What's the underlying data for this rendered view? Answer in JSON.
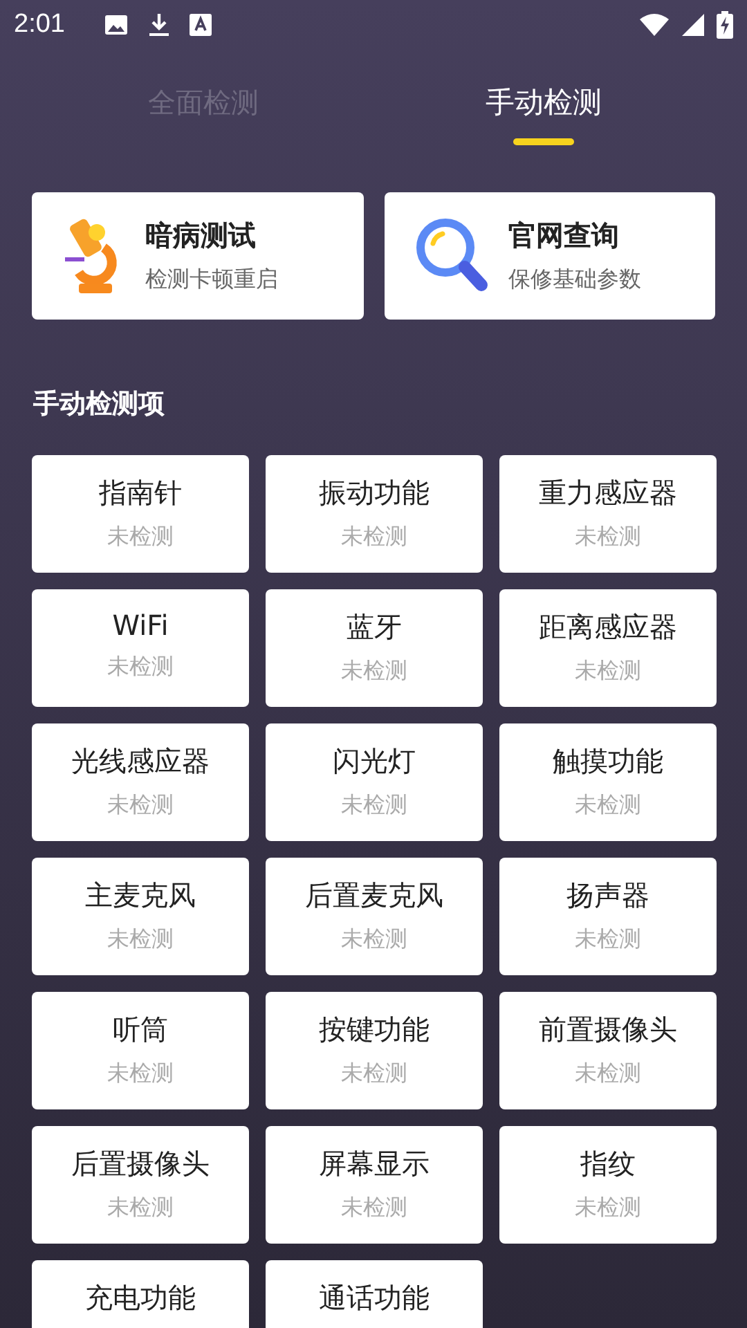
{
  "status_bar": {
    "time": "2:01"
  },
  "tabs": [
    {
      "label": "全面检测",
      "selected": false
    },
    {
      "label": "手动检测",
      "selected": true
    }
  ],
  "cards": [
    {
      "kind": "microscope",
      "title": "暗病测试",
      "subtitle": "检测卡顿重启"
    },
    {
      "kind": "magnifier",
      "title": "官网查询",
      "subtitle": "保修基础参数"
    }
  ],
  "section_title": "手动检测项",
  "items": [
    {
      "name": "指南针",
      "status": "未检测"
    },
    {
      "name": "振动功能",
      "status": "未检测"
    },
    {
      "name": "重力感应器",
      "status": "未检测"
    },
    {
      "name": "WiFi",
      "status": "未检测"
    },
    {
      "name": "蓝牙",
      "status": "未检测"
    },
    {
      "name": "距离感应器",
      "status": "未检测"
    },
    {
      "name": "光线感应器",
      "status": "未检测"
    },
    {
      "name": "闪光灯",
      "status": "未检测"
    },
    {
      "name": "触摸功能",
      "status": "未检测"
    },
    {
      "name": "主麦克风",
      "status": "未检测"
    },
    {
      "name": "后置麦克风",
      "status": "未检测"
    },
    {
      "name": "扬声器",
      "status": "未检测"
    },
    {
      "name": "听筒",
      "status": "未检测"
    },
    {
      "name": "按键功能",
      "status": "未检测"
    },
    {
      "name": "前置摄像头",
      "status": "未检测"
    },
    {
      "name": "后置摄像头",
      "status": "未检测"
    },
    {
      "name": "屏幕显示",
      "status": "未检测"
    },
    {
      "name": "指纹",
      "status": "未检测"
    },
    {
      "name": "充电功能"
    },
    {
      "name": "通话功能"
    }
  ]
}
